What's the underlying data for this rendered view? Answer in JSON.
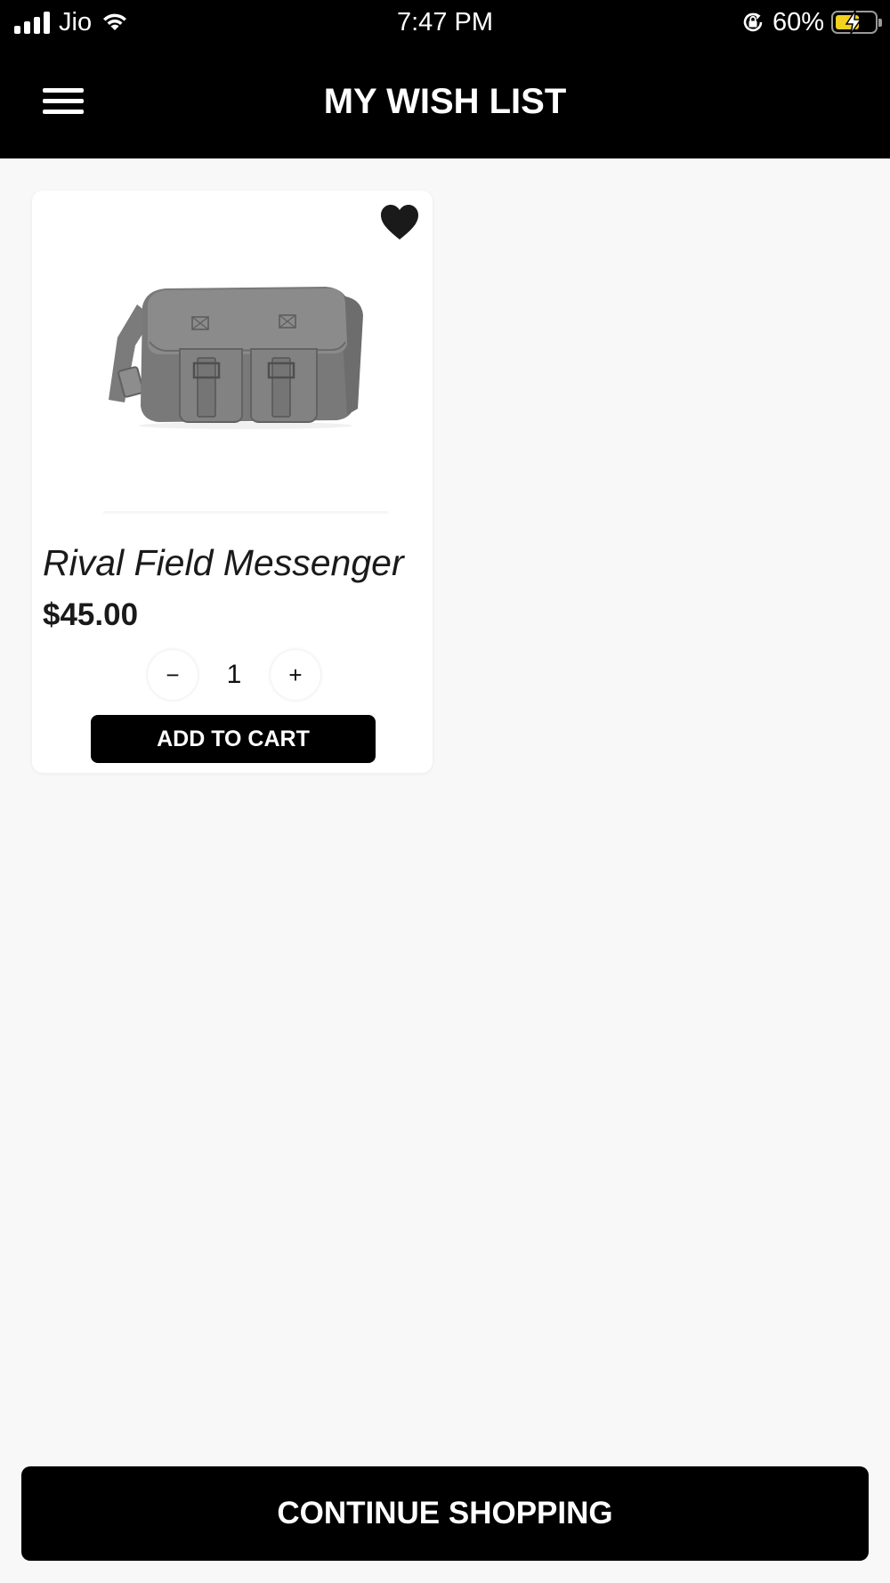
{
  "status_bar": {
    "carrier": "Jio",
    "time": "7:47 PM",
    "battery_percent_text": "60%",
    "battery_level": 0.6,
    "battery_fill_color": "#f2d11f"
  },
  "header": {
    "title": "MY WISH LIST",
    "menu_icon": "hamburger-menu-icon"
  },
  "wishlist": {
    "items": [
      {
        "name": "Rival Field Messenger",
        "price": "$45.00",
        "quantity": "1",
        "decrement_symbol": "−",
        "increment_symbol": "+",
        "add_to_cart_label": "ADD TO CART",
        "favorite_icon": "heart-filled-icon",
        "image": "gray-messenger-bag"
      }
    ]
  },
  "footer": {
    "continue_label": "CONTINUE SHOPPING"
  }
}
